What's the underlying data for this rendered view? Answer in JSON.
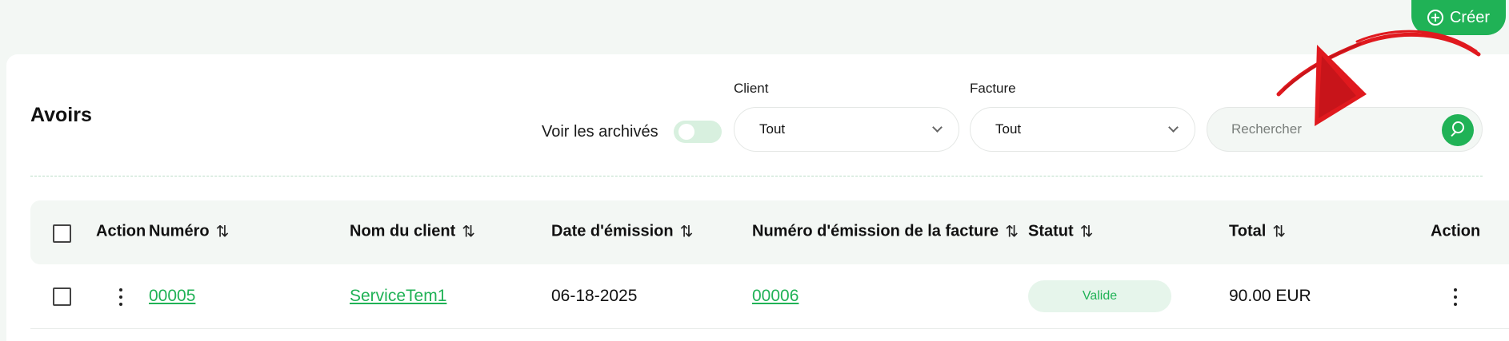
{
  "header": {
    "create_label": "Créer"
  },
  "page": {
    "title": "Avoirs"
  },
  "filters": {
    "archive_label": "Voir les archivés",
    "archive_on": false,
    "client_label": "Client",
    "client_value": "Tout",
    "invoice_label": "Facture",
    "invoice_value": "Tout",
    "search_placeholder": "Rechercher"
  },
  "table": {
    "columns": {
      "action": "Action",
      "number": "Numéro",
      "client": "Nom du client",
      "date": "Date d'émission",
      "invoice": "Numéro d'émission de la facture",
      "status": "Statut",
      "total": "Total",
      "action_right": "Action"
    },
    "sort_icon": "⇅",
    "rows": [
      {
        "number": "00005",
        "client": "ServiceTem1",
        "date": "06-18-2025",
        "invoice": "00006",
        "status": "Valide",
        "total": "90.00 EUR"
      }
    ]
  },
  "colors": {
    "accent": "#20b256",
    "annotation_arrow": "#e0191e"
  }
}
